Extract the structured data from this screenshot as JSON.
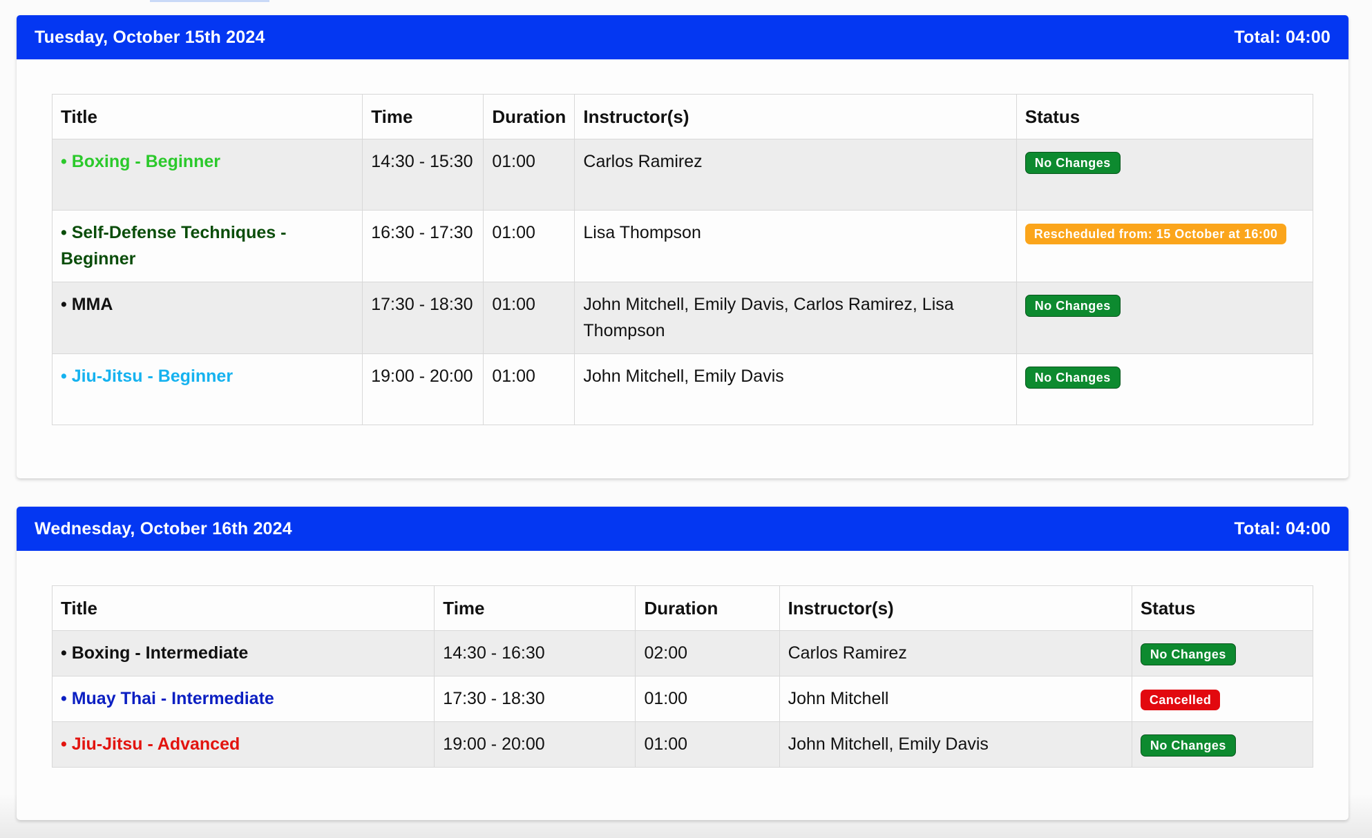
{
  "days": [
    {
      "date": "Tuesday, October 15th 2024",
      "total": "Total: 04:00",
      "headers": [
        "Title",
        "Time",
        "Duration",
        "Instructor(s)",
        "Status"
      ],
      "rows": [
        {
          "title": "• Boxing - Beginner",
          "color": "#2bc92b",
          "time": "14:30 - 15:30",
          "duration": "01:00",
          "instructors": "Carlos Ramirez",
          "status": "No Changes",
          "status_color": "#0d8a2f"
        },
        {
          "title": "• Self-Defense Techniques - Beginner",
          "color": "#0a4d0a",
          "time": "16:30 - 17:30",
          "duration": "01:00",
          "instructors": "Lisa Thompson",
          "status": "Rescheduled from: 15 October at 16:00",
          "status_color": "#fba51b"
        },
        {
          "title": "• MMA",
          "color": "#111111",
          "time": "17:30 - 18:30",
          "duration": "01:00",
          "instructors": "John Mitchell, Emily Davis, Carlos Ramirez, Lisa Thompson",
          "status": "No Changes",
          "status_color": "#0d8a2f"
        },
        {
          "title": "• Jiu-Jitsu - Beginner",
          "color": "#15b2ef",
          "time": "19:00 - 20:00",
          "duration": "01:00",
          "instructors": "John Mitchell, Emily Davis",
          "status": "No Changes",
          "status_color": "#0d8a2f"
        }
      ]
    },
    {
      "date": "Wednesday, October 16th 2024",
      "total": "Total: 04:00",
      "headers": [
        "Title",
        "Time",
        "Duration",
        "Instructor(s)",
        "Status"
      ],
      "rows": [
        {
          "title": "• Boxing - Intermediate",
          "color": "#111111",
          "time": "14:30 - 16:30",
          "duration": "02:00",
          "instructors": "Carlos Ramirez",
          "status": "No Changes",
          "status_color": "#0d8a2f"
        },
        {
          "title": "• Muay Thai - Intermediate",
          "color": "#0b1fc2",
          "time": "17:30 - 18:30",
          "duration": "01:00",
          "instructors": "John Mitchell",
          "status": "Cancelled",
          "status_color": "#e2090f"
        },
        {
          "title": "• Jiu-Jitsu - Advanced",
          "color": "#e2140f",
          "time": "19:00 - 20:00",
          "duration": "01:00",
          "instructors": "John Mitchell, Emily Davis",
          "status": "No Changes",
          "status_color": "#0d8a2f"
        }
      ]
    }
  ],
  "colors": {
    "header_bg": "#0437f2",
    "stripe": "#ededed"
  }
}
